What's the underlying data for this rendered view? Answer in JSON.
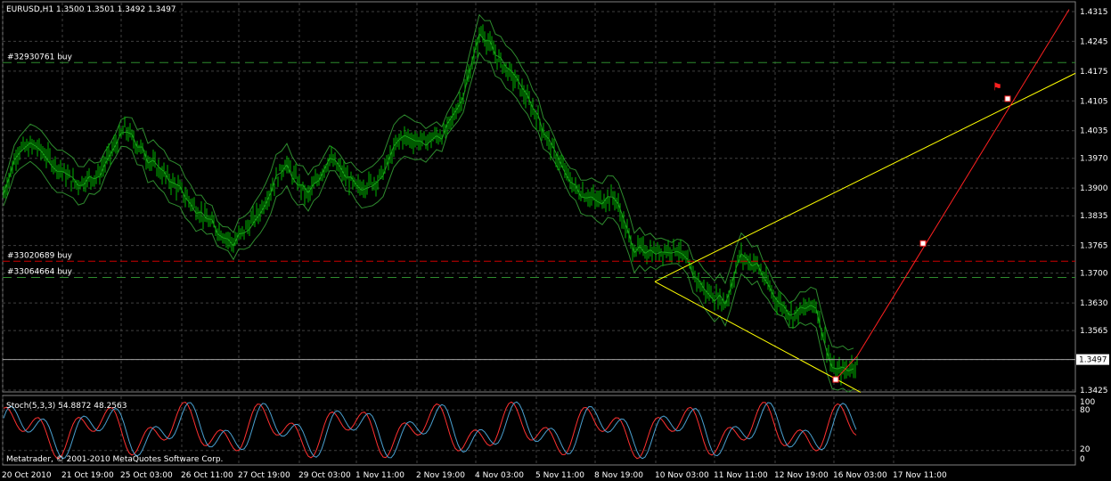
{
  "window": {
    "symbol_header": "EURUSD,H1  1.3500 1.3501 1.3492 1.3497"
  },
  "price_axis": {
    "ticks": [
      "1.4315",
      "1.4245",
      "1.4175",
      "1.4105",
      "1.4035",
      "1.3970",
      "1.3900",
      "1.3835",
      "1.3765",
      "1.3700",
      "1.3630",
      "1.3565",
      "1.3497",
      "1.3425"
    ],
    "current_price": "1.3497"
  },
  "time_axis": {
    "ticks": [
      "20 Oct 2010",
      "21 Oct 19:00",
      "25 Oct 03:00",
      "26 Oct 11:00",
      "27 Oct 19:00",
      "29 Oct 03:00",
      "1 Nov 11:00",
      "2 Nov 19:00",
      "4 Nov 03:00",
      "5 Nov 11:00",
      "8 Nov 19:00",
      "10 Nov 03:00",
      "11 Nov 11:00",
      "12 Nov 19:00",
      "16 Nov 03:00",
      "17 Nov 11:00"
    ]
  },
  "orders": [
    {
      "label": "#32930761 buy",
      "price": 1.4195,
      "color": "#2e8b2e"
    },
    {
      "label": "#33020689 buy",
      "price": 1.3728,
      "color": "#cc0000"
    },
    {
      "label": "#33064664 buy",
      "price": 1.369,
      "color": "#2e8b2e"
    }
  ],
  "stoch_panel": {
    "title": "Stoch(5,3,3) 54.8872 48.2563",
    "levels": [
      "100",
      "80",
      "20",
      "0"
    ],
    "copyright": "Metatrader, © 2001-2010 MetaQuotes Software Corp."
  },
  "colors": {
    "background": "#000000",
    "candles": "#00b400",
    "bands": "#2e8b2e",
    "trendline": "#ffff00",
    "projection": "#ff2020",
    "stoch_main": "#4aa0d0",
    "stoch_signal": "#ff3030",
    "grid": "#404040"
  }
}
